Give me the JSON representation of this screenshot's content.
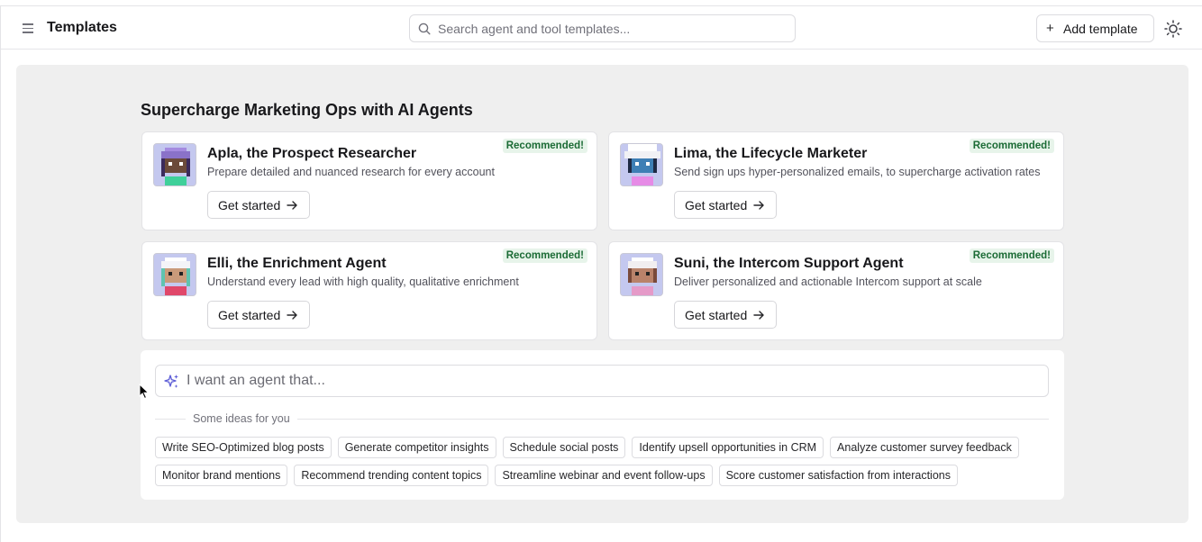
{
  "header": {
    "title": "Templates",
    "search_placeholder": "Search agent and tool templates...",
    "add_label": "Add template"
  },
  "main": {
    "section_title": "Supercharge Marketing Ops with AI Agents",
    "cards": [
      {
        "name": "Apla, the Prospect Researcher",
        "description": "Prepare detailed and nuanced research for every account",
        "badge": "Recommended!",
        "cta": "Get started"
      },
      {
        "name": "Lima, the Lifecycle Marketer",
        "description": "Send sign ups hyper-personalized emails, to supercharge activation rates",
        "badge": "Recommended!",
        "cta": "Get started"
      },
      {
        "name": "Elli, the Enrichment Agent",
        "description": "Understand every lead with high quality, qualitative enrichment",
        "badge": "Recommended!",
        "cta": "Get started"
      },
      {
        "name": "Suni, the Intercom Support Agent",
        "description": "Deliver personalized and actionable Intercom support at scale",
        "badge": "Recommended!",
        "cta": "Get started"
      }
    ],
    "prompt": {
      "placeholder": "I want an agent that...",
      "ideas_label": "Some ideas for you",
      "ideas_row1": [
        "Write SEO-Optimized blog posts",
        "Generate competitor insights",
        "Schedule social posts",
        "Identify upsell opportunities in CRM",
        "Analyze customer survey feedback"
      ],
      "ideas_row2": [
        "Monitor brand mentions",
        "Recommend trending content topics",
        "Streamline webinar and event follow-ups",
        "Score customer satisfaction from interactions"
      ]
    }
  },
  "colors": {
    "accent_sparkle": "#5b5bd6",
    "badge_bg": "#e7f4ea",
    "badge_text": "#1b6b35",
    "panel_bg": "#efefef"
  },
  "icons": {
    "menu": "hamburger-icon",
    "search": "search-icon",
    "add": "plus-icon",
    "theme": "sun-icon",
    "cta": "arrow-right-icon",
    "prompt": "sparkles-icon"
  }
}
